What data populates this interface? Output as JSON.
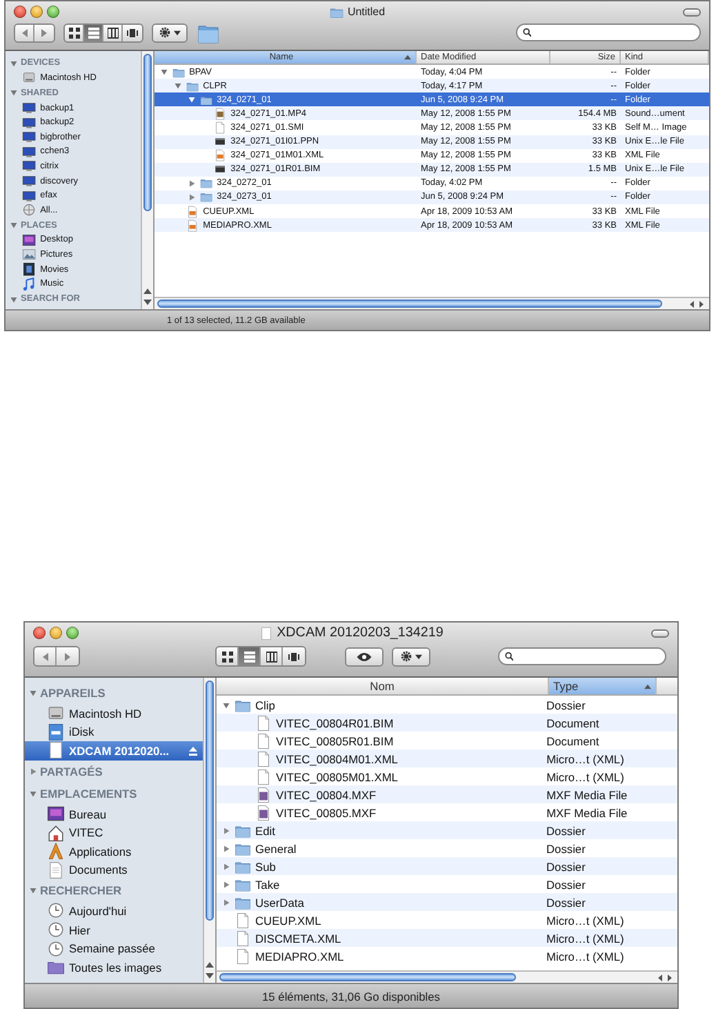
{
  "windows": [
    {
      "title": "Untitled",
      "kind": "folder",
      "views": [
        {
          "selected": false
        },
        {
          "selected": true
        },
        {
          "selected": false
        },
        {
          "selected": false
        }
      ],
      "extras": [
        {
          "kind": "gear"
        },
        {
          "kind": "folder"
        }
      ],
      "sidebar": [
        {
          "heading": "DEVICES",
          "expanded": true,
          "items": [
            {
              "label": "Macintosh HD",
              "kind": "disk",
              "selected": false
            }
          ]
        },
        {
          "heading": "SHARED",
          "expanded": true,
          "items": [
            {
              "label": "backup1",
              "kind": "computer",
              "selected": false
            },
            {
              "label": "backup2",
              "kind": "computer",
              "selected": false
            },
            {
              "label": "bigbrother",
              "kind": "computer",
              "selected": false
            },
            {
              "label": "cchen3",
              "kind": "computer",
              "selected": false
            },
            {
              "label": "citrix",
              "kind": "computer",
              "selected": false
            },
            {
              "label": "discovery",
              "kind": "computer",
              "selected": false
            },
            {
              "label": "efax",
              "kind": "computer",
              "selected": false
            },
            {
              "label": "All...",
              "kind": "network",
              "selected": false
            }
          ]
        },
        {
          "heading": "PLACES",
          "expanded": true,
          "items": [
            {
              "label": "Desktop",
              "kind": "desktop",
              "selected": false
            },
            {
              "label": "Pictures",
              "kind": "pictures",
              "selected": false
            },
            {
              "label": "Movies",
              "kind": "movies",
              "selected": false
            },
            {
              "label": "Music",
              "kind": "music",
              "selected": false
            }
          ]
        },
        {
          "heading": "SEARCH FOR",
          "expanded": true
        }
      ],
      "columns": [
        {
          "label": "Name",
          "selected": true
        },
        {
          "label": "Date Modified",
          "selected": false
        },
        {
          "label": "Size",
          "selected": false
        },
        {
          "label": "Kind",
          "selected": false
        }
      ],
      "rows": [
        {
          "kind": "folder",
          "expanded": true,
          "selected": false,
          "cells": [
            "BPAV",
            "Today, 4:04 PM",
            "--",
            "Folder"
          ],
          "children": [
            {
              "kind": "folder",
              "expanded": true,
              "selected": false,
              "cells": [
                "CLPR",
                "Today, 4:17 PM",
                "--",
                "Folder"
              ],
              "children": [
                {
                  "kind": "folder",
                  "expanded": true,
                  "selected": true,
                  "cells": [
                    "324_0271_01",
                    "Jun 5, 2008 9:24 PM",
                    "--",
                    "Folder"
                  ],
                  "children": [
                    {
                      "kind": "media",
                      "selected": false,
                      "cells": [
                        "324_0271_01.MP4",
                        "May 12, 2008 1:55 PM",
                        "154.4 MB",
                        "Sound…ument"
                      ]
                    },
                    {
                      "kind": "file",
                      "selected": false,
                      "cells": [
                        "324_0271_01.SMI",
                        "May 12, 2008 1:55 PM",
                        "33 KB",
                        "Self M… Image"
                      ]
                    },
                    {
                      "kind": "binary",
                      "selected": false,
                      "cells": [
                        "324_0271_01I01.PPN",
                        "May 12, 2008 1:55 PM",
                        "33 KB",
                        "Unix E…le File"
                      ]
                    },
                    {
                      "kind": "xml",
                      "selected": false,
                      "cells": [
                        "324_0271_01M01.XML",
                        "May 12, 2008 1:55 PM",
                        "33 KB",
                        "XML File"
                      ]
                    },
                    {
                      "kind": "binary",
                      "selected": false,
                      "cells": [
                        "324_0271_01R01.BIM",
                        "May 12, 2008 1:55 PM",
                        "1.5 MB",
                        "Unix E…le File"
                      ]
                    }
                  ]
                },
                {
                  "kind": "folder",
                  "expanded": false,
                  "selected": false,
                  "cells": [
                    "324_0272_01",
                    "Today, 4:02 PM",
                    "--",
                    "Folder"
                  ]
                },
                {
                  "kind": "folder",
                  "expanded": false,
                  "selected": false,
                  "cells": [
                    "324_0273_01",
                    "Jun 5, 2008 9:24 PM",
                    "--",
                    "Folder"
                  ]
                }
              ]
            },
            {
              "kind": "xml",
              "selected": false,
              "cells": [
                "CUEUP.XML",
                "Apr 18, 2009 10:53 AM",
                "33 KB",
                "XML File"
              ]
            },
            {
              "kind": "xml",
              "selected": false,
              "cells": [
                "MEDIAPRO.XML",
                "Apr 18, 2009 10:53 AM",
                "33 KB",
                "XML File"
              ]
            }
          ]
        }
      ],
      "status": "1 of 13 selected, 11.2 GB available"
    },
    {
      "title": "XDCAM 20120203_134219",
      "kind": "volume",
      "views": [
        {
          "selected": false
        },
        {
          "selected": true
        },
        {
          "selected": false
        },
        {
          "selected": false
        }
      ],
      "extras": [
        {
          "kind": "eye"
        },
        {
          "kind": "gear"
        }
      ],
      "sidebar": [
        {
          "heading": "APPAREILS",
          "expanded": true,
          "items": [
            {
              "label": "Macintosh HD",
              "kind": "disk",
              "selected": false
            },
            {
              "label": "iDisk",
              "kind": "idisk",
              "selected": false
            },
            {
              "label": "XDCAM 2012020...",
              "kind": "volume",
              "selected": true
            }
          ]
        },
        {
          "heading": "PARTAGÉS",
          "expanded": false
        },
        {
          "heading": "EMPLACEMENTS",
          "expanded": true,
          "items": [
            {
              "label": "Bureau",
              "kind": "desktop",
              "selected": false
            },
            {
              "label": "VITEC",
              "kind": "home",
              "selected": false
            },
            {
              "label": "Applications",
              "kind": "apps",
              "selected": false
            },
            {
              "label": "Documents",
              "kind": "docs",
              "selected": false
            }
          ]
        },
        {
          "heading": "RECHERCHER",
          "expanded": true,
          "items": [
            {
              "label": "Aujourd'hui",
              "kind": "clock",
              "selected": false
            },
            {
              "label": "Hier",
              "kind": "clock",
              "selected": false
            },
            {
              "label": "Semaine passée",
              "kind": "clock",
              "selected": false
            },
            {
              "label": "Toutes les images",
              "kind": "smart",
              "selected": false
            }
          ]
        }
      ],
      "columns": [
        {
          "label": "Nom",
          "selected": false
        },
        {
          "label": "Type",
          "selected": true
        }
      ],
      "rows": [
        {
          "kind": "folder",
          "expanded": true,
          "selected": false,
          "cells": [
            "Clip",
            "Dossier"
          ],
          "children": [
            {
              "kind": "file",
              "selected": false,
              "cells": [
                "VITEC_00804R01.BIM",
                "Document"
              ]
            },
            {
              "kind": "file",
              "selected": false,
              "cells": [
                "VITEC_00805R01.BIM",
                "Document"
              ]
            },
            {
              "kind": "file",
              "selected": false,
              "cells": [
                "VITEC_00804M01.XML",
                "Micro…t (XML)"
              ]
            },
            {
              "kind": "file",
              "selected": false,
              "cells": [
                "VITEC_00805M01.XML",
                "Micro…t (XML)"
              ]
            },
            {
              "kind": "mxf",
              "selected": false,
              "cells": [
                "VITEC_00804.MXF",
                "MXF Media File"
              ]
            },
            {
              "kind": "mxf",
              "selected": false,
              "cells": [
                "VITEC_00805.MXF",
                "MXF Media File"
              ]
            }
          ]
        },
        {
          "kind": "folder",
          "expanded": false,
          "selected": false,
          "cells": [
            "Edit",
            "Dossier"
          ]
        },
        {
          "kind": "folder",
          "expanded": false,
          "selected": false,
          "cells": [
            "General",
            "Dossier"
          ]
        },
        {
          "kind": "folder",
          "expanded": false,
          "selected": false,
          "cells": [
            "Sub",
            "Dossier"
          ]
        },
        {
          "kind": "folder",
          "expanded": false,
          "selected": false,
          "cells": [
            "Take",
            "Dossier"
          ]
        },
        {
          "kind": "folder",
          "expanded": false,
          "selected": false,
          "cells": [
            "UserData",
            "Dossier"
          ]
        },
        {
          "kind": "file",
          "selected": false,
          "cells": [
            "CUEUP.XML",
            "Micro…t (XML)"
          ]
        },
        {
          "kind": "file",
          "selected": false,
          "cells": [
            "DISCMETA.XML",
            "Micro…t (XML)"
          ]
        },
        {
          "kind": "file",
          "selected": false,
          "cells": [
            "MEDIAPRO.XML",
            "Micro…t (XML)"
          ]
        }
      ],
      "status": "15 éléments, 31,06 Go disponibles"
    }
  ]
}
